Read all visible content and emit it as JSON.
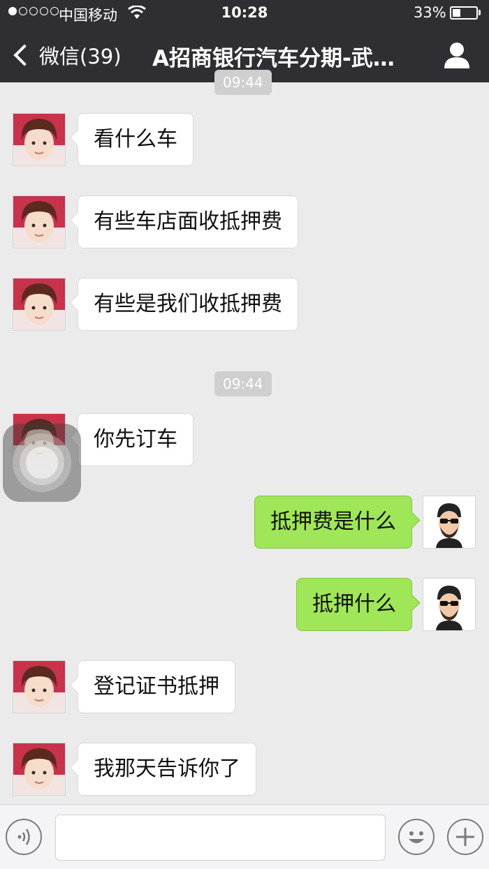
{
  "status_bar": {
    "carrier": "中国移动",
    "time": "10:28",
    "battery": "33%",
    "battery_level": 0.33,
    "signal_bars": 1
  },
  "nav": {
    "back_label": "微信(39)",
    "title": "A招商银行汽车分期-武…"
  },
  "timestamps": [
    "09:44",
    "09:44"
  ],
  "messages": [
    {
      "side": "in",
      "text": "看什么车"
    },
    {
      "side": "in",
      "text": "有些车店面收抵押费"
    },
    {
      "side": "in",
      "text": "有些是我们收抵押费"
    },
    {
      "side": "in",
      "text": "你先订车"
    },
    {
      "side": "out",
      "text": "抵押费是什么"
    },
    {
      "side": "out",
      "text": "抵押什么"
    },
    {
      "side": "in",
      "text": "登记证书抵押"
    },
    {
      "side": "in",
      "text": "我那天告诉你了"
    }
  ],
  "input_bar": {
    "placeholder": "",
    "icons": [
      "voice-icon",
      "emoji-icon",
      "plus-icon"
    ]
  },
  "colors": {
    "nav_bg": "#2f2f33",
    "chat_bg": "#ebebeb",
    "bubble_out": "#9fe658",
    "bubble_in": "#ffffff"
  }
}
